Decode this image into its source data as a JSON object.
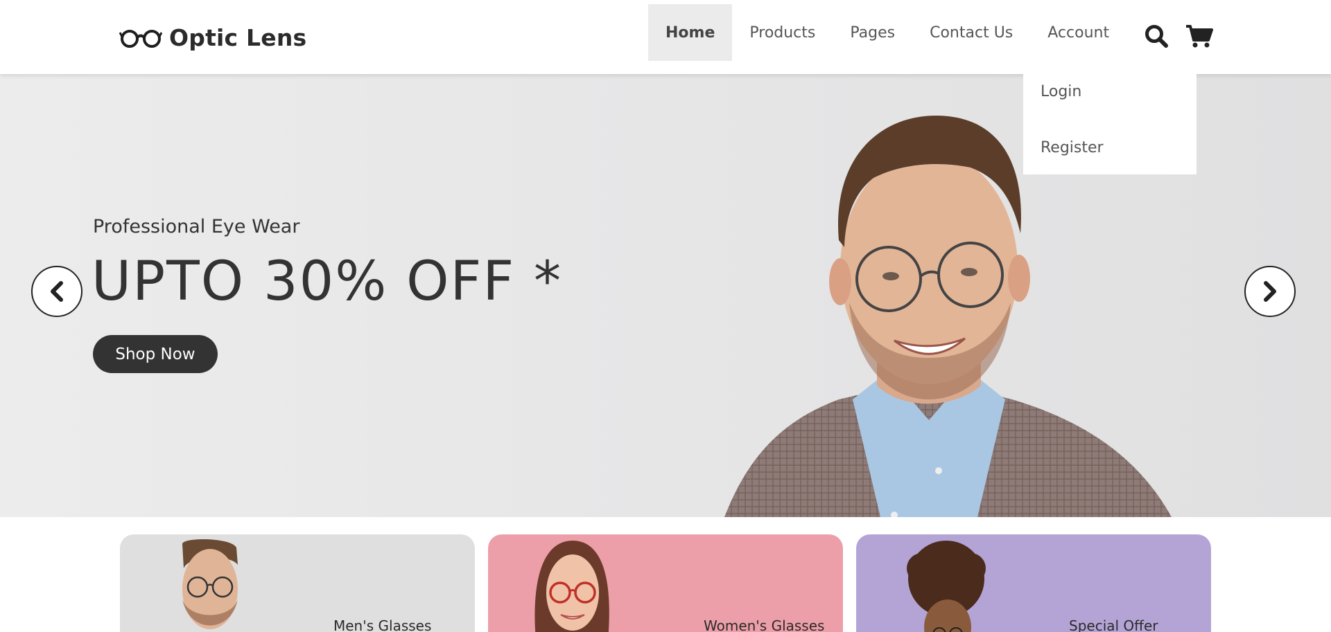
{
  "header": {
    "logo_text": "Optic Lens",
    "nav": [
      {
        "label": "Home",
        "active": true
      },
      {
        "label": "Products"
      },
      {
        "label": "Pages"
      },
      {
        "label": "Contact Us"
      },
      {
        "label": "Account"
      }
    ],
    "icons": [
      "search-icon",
      "cart-icon"
    ]
  },
  "account_dropdown": {
    "items": [
      "Login",
      "Register"
    ]
  },
  "hero": {
    "subtitle": "Professional Eye Wear",
    "title": "UPTO 30% OFF *",
    "cta_label": "Shop Now"
  },
  "categories": [
    {
      "label": "Men's Glasses",
      "color": "#dfdfdf"
    },
    {
      "label": "Women's Glasses",
      "color": "#ec9fa8"
    },
    {
      "label": "Special Offer",
      "color": "#b4a4d6"
    }
  ],
  "colors": {
    "accent_dark": "#333333",
    "nav_active_bg": "#ebebeb"
  }
}
